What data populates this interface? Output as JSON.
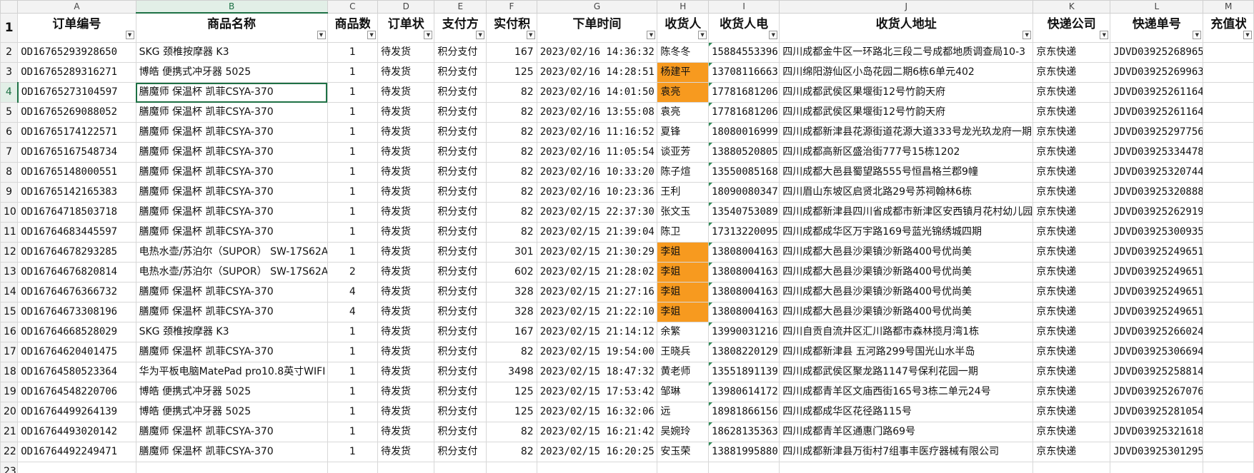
{
  "columns": [
    "A",
    "B",
    "C",
    "D",
    "E",
    "F",
    "G",
    "H",
    "I",
    "J",
    "K",
    "L",
    "M"
  ],
  "headers": [
    "订单编号",
    "商品名称",
    "商品数",
    "订单状",
    "支付方",
    "实付积",
    "下单时间",
    "收货人",
    "收货人电",
    "收货人地址",
    "快递公司",
    "快递单号",
    "充值状"
  ],
  "rows": [
    [
      "OD16765293928650",
      "SKG 颈椎按摩器 K3",
      "1",
      "待发货",
      "积分支付",
      "167",
      "2023/02/16 14:36:32",
      "陈冬冬",
      "15884553396",
      "四川成都金牛区一环路北三段二号成都地质调查局10-3",
      "京东快递",
      "JDVD03925268965",
      ""
    ],
    [
      "OD16765289316271",
      "博皓 便携式冲牙器 5025",
      "1",
      "待发货",
      "积分支付",
      "125",
      "2023/02/16 14:28:51",
      "杨建平",
      "13708116663",
      "四川绵阳游仙区小岛花园二期6栋6单元402",
      "京东快递",
      "JDVD03925269963",
      ""
    ],
    [
      "OD16765273104597",
      "膳魔师 保温杯 凯菲CSYA-370",
      "1",
      "待发货",
      "积分支付",
      "82",
      "2023/02/16 14:01:50",
      "袁亮",
      "17781681206",
      "四川成都武侯区果堰街12号竹韵天府",
      "京东快递",
      "JDVD03925261164",
      ""
    ],
    [
      "OD16765269088052",
      "膳魔师 保温杯 凯菲CSYA-370",
      "1",
      "待发货",
      "积分支付",
      "82",
      "2023/02/16 13:55:08",
      "袁亮",
      "17781681206",
      "四川成都武侯区果堰街12号竹韵天府",
      "京东快递",
      "JDVD03925261164",
      ""
    ],
    [
      "OD16765174122571",
      "膳魔师 保温杯 凯菲CSYA-370",
      "1",
      "待发货",
      "积分支付",
      "82",
      "2023/02/16 11:16:52",
      "夏锋",
      "18080016999",
      "四川成都新津县花源街道花源大道333号龙光玖龙府一期",
      "京东快递",
      "JDVD03925297756",
      ""
    ],
    [
      "OD16765167548734",
      "膳魔师 保温杯 凯菲CSYA-370",
      "1",
      "待发货",
      "积分支付",
      "82",
      "2023/02/16 11:05:54",
      "谈亚芳",
      "13880520805",
      "四川成都高新区盛治街777号15栋1202",
      "京东快递",
      "JDVD03925334478",
      ""
    ],
    [
      "OD16765148000551",
      "膳魔师 保温杯 凯菲CSYA-370",
      "1",
      "待发货",
      "积分支付",
      "82",
      "2023/02/16 10:33:20",
      "陈子煊",
      "13550085168",
      "四川成都大邑县蜀望路555号恒昌格兰郡9幢",
      "京东快递",
      "JDVD03925320744",
      ""
    ],
    [
      "OD16765142165383",
      "膳魔师 保温杯 凯菲CSYA-370",
      "1",
      "待发货",
      "积分支付",
      "82",
      "2023/02/16 10:23:36",
      "王利",
      "18090080347",
      "四川眉山东坡区启贤北路29号苏祠翰林6栋",
      "京东快递",
      "JDVD03925320888",
      ""
    ],
    [
      "OD16764718503718",
      "膳魔师 保温杯 凯菲CSYA-370",
      "1",
      "待发货",
      "积分支付",
      "82",
      "2023/02/15 22:37:30",
      "张文玉",
      "13540753089",
      "四川成都新津县四川省成都市新津区安西镇月花村幼儿园",
      "京东快递",
      "JDVD03925262919",
      ""
    ],
    [
      "OD16764683445597",
      "膳魔师 保温杯 凯菲CSYA-370",
      "1",
      "待发货",
      "积分支付",
      "82",
      "2023/02/15 21:39:04",
      "陈卫",
      "17313220095",
      "四川成都成华区万宇路169号蓝光锦绣城四期",
      "京东快递",
      "JDVD03925300935",
      ""
    ],
    [
      "OD16764678293285",
      "电热水壶/苏泊尔（SUPOR） SW-17S62A",
      "1",
      "待发货",
      "积分支付",
      "301",
      "2023/02/15 21:30:29",
      "李姐",
      "13808004163",
      "四川成都大邑县沙渠镇沙新路400号优尚美",
      "京东快递",
      "JDVD03925249651",
      ""
    ],
    [
      "OD16764676820814",
      "电热水壶/苏泊尔（SUPOR） SW-17S62A",
      "2",
      "待发货",
      "积分支付",
      "602",
      "2023/02/15 21:28:02",
      "李姐",
      "13808004163",
      "四川成都大邑县沙渠镇沙新路400号优尚美",
      "京东快递",
      "JDVD03925249651",
      ""
    ],
    [
      "OD16764676366732",
      "膳魔师 保温杯 凯菲CSYA-370",
      "4",
      "待发货",
      "积分支付",
      "328",
      "2023/02/15 21:27:16",
      "李姐",
      "13808004163",
      "四川成都大邑县沙渠镇沙新路400号优尚美",
      "京东快递",
      "JDVD03925249651",
      ""
    ],
    [
      "OD16764673308196",
      "膳魔师 保温杯 凯菲CSYA-370",
      "4",
      "待发货",
      "积分支付",
      "328",
      "2023/02/15 21:22:10",
      "李姐",
      "13808004163",
      "四川成都大邑县沙渠镇沙新路400号优尚美",
      "京东快递",
      "JDVD03925249651",
      ""
    ],
    [
      "OD16764668528029",
      "SKG 颈椎按摩器 K3",
      "1",
      "待发货",
      "积分支付",
      "167",
      "2023/02/15 21:14:12",
      "余繁",
      "13990031216",
      "四川自贡自流井区汇川路都市森林揽月湾1栋",
      "京东快递",
      "JDVD03925266024",
      ""
    ],
    [
      "OD16764620401475",
      "膳魔师 保温杯 凯菲CSYA-370",
      "1",
      "待发货",
      "积分支付",
      "82",
      "2023/02/15 19:54:00",
      "王晓兵",
      "13808220129",
      "四川成都新津县 五河路299号国光山水半岛",
      "京东快递",
      "JDVD03925306694",
      ""
    ],
    [
      "OD16764580523364",
      "华为平板电脑MatePad pro10.8英寸WIFI",
      "1",
      "待发货",
      "积分支付",
      "3498",
      "2023/02/15 18:47:32",
      "黄老师",
      "13551891139",
      "四川成都武侯区聚龙路1147号保利花园一期",
      "京东快递",
      "JDVD03925258814",
      ""
    ],
    [
      "OD16764548220706",
      "博皓 便携式冲牙器 5025",
      "1",
      "待发货",
      "积分支付",
      "125",
      "2023/02/15 17:53:42",
      "邹琳",
      "13980614172",
      "四川成都青羊区文庙西街165号3栋二单元24号",
      "京东快递",
      "JDVD03925267076",
      ""
    ],
    [
      "OD16764499264139",
      "博皓 便携式冲牙器 5025",
      "1",
      "待发货",
      "积分支付",
      "125",
      "2023/02/15 16:32:06",
      "远",
      "18981866156",
      "四川成都成华区花径路115号",
      "京东快递",
      "JDVD03925281054",
      ""
    ],
    [
      "OD16764493020142",
      "膳魔师 保温杯 凯菲CSYA-370",
      "1",
      "待发货",
      "积分支付",
      "82",
      "2023/02/15 16:21:42",
      "吴婉玲",
      "18628135363",
      "四川成都青羊区通惠门路69号",
      "京东快递",
      "JDVD03925321618",
      ""
    ],
    [
      "OD16764492249471",
      "膳魔师 保温杯 凯菲CSYA-370",
      "1",
      "待发货",
      "积分支付",
      "82",
      "2023/02/15 16:20:25",
      "安玉荣",
      "13881995880",
      "四川成都新津县万街村7组事丰医疗器械有限公司",
      "京东快递",
      "JDVD03925301295",
      ""
    ]
  ],
  "row_numbers": [
    "1",
    "2",
    "3",
    "4",
    "5",
    "6",
    "7",
    "8",
    "9",
    "10",
    "11",
    "12",
    "13",
    "14",
    "15",
    "16",
    "17",
    "18",
    "19",
    "20",
    "21",
    "22",
    "23"
  ],
  "highlight_color": "#f79a1f",
  "accent_color": "#1e7145",
  "active_cell": "B4",
  "highlighted_name_rows": [
    3,
    4,
    12,
    13,
    14,
    15
  ],
  "filter_icon": "dropdown-filter-icon"
}
